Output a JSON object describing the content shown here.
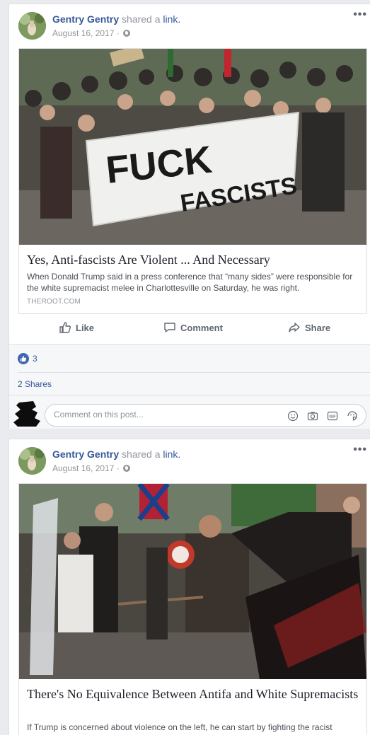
{
  "posts": [
    {
      "author": "Gentry Gentry",
      "action_text": "shared a",
      "action_link": "link.",
      "date": "August 16, 2017",
      "date_separator": "·",
      "more_label": "•••",
      "image_banner_text_1": "FUCK",
      "image_banner_text_2": "FASCISTS",
      "title": "Yes, Anti-fascists Are Violent ... And Necessary",
      "description": "When Donald Trump said in a press conference that “many sides” were responsible for the white supremacist melee in Charlottesville on Saturday, he was right.",
      "domain": "THEROOT.COM",
      "actions": {
        "like": "Like",
        "comment": "Comment",
        "share": "Share"
      },
      "reaction_count": "3",
      "shares": "2 Shares",
      "comment_placeholder": "Comment on this post..."
    },
    {
      "author": "Gentry Gentry",
      "action_text": "shared a",
      "action_link": "link.",
      "date": "August 16, 2017",
      "date_separator": "·",
      "more_label": "•••",
      "title": "There's No Equivalence Between Antifa and White Supremacists",
      "description": "If Trump is concerned about violence on the left, he can start by fighting the racist"
    }
  ],
  "icons": [
    "globe-icon",
    "more-options-icon",
    "like-icon",
    "comment-icon",
    "share-icon",
    "emoji-icon",
    "camera-icon",
    "gif-icon",
    "sticker-icon"
  ],
  "colors": {
    "link_blue": "#365899",
    "like_badge": "#4267b2",
    "meta_gray": "#90949c",
    "background": "#e9ebee"
  }
}
